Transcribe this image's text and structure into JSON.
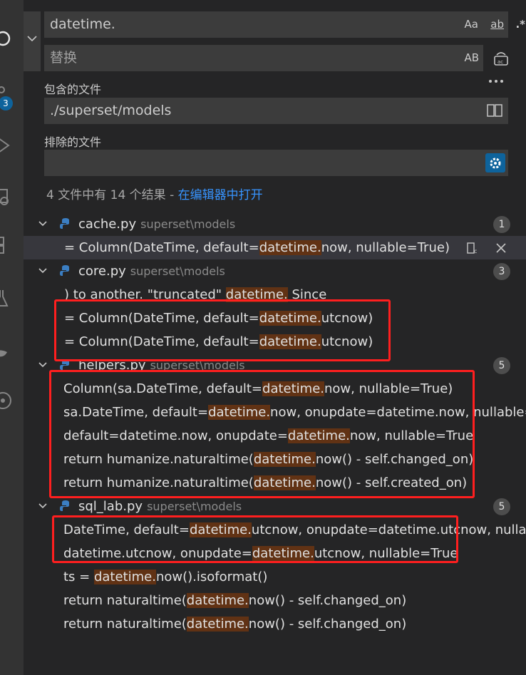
{
  "activity_bar": {
    "badge": "3"
  },
  "search": {
    "find_value": "datetime.",
    "find_options": {
      "match_case": "Aa",
      "whole_word": "ab",
      "regex": ".*"
    },
    "replace_placeholder": "替换",
    "preserve_case": "AB",
    "include_label": "包含的文件",
    "include_value": "./superset/models",
    "exclude_label": "排除的文件",
    "exclude_value": "",
    "summary_text": "4 文件中有 14 个结果 - ",
    "summary_link": "在编辑器中打开"
  },
  "results": [
    {
      "file": "cache.py",
      "path": "superset\\models",
      "count": "1",
      "matches": [
        {
          "pre": "= Column(DateTime, default=",
          "hit": "datetime.",
          "post": "now, nullable=True)"
        }
      ]
    },
    {
      "file": "core.py",
      "path": "superset\\models",
      "count": "3",
      "matches": [
        {
          "pre": ") to another. \"truncated\" ",
          "hit": "datetime.",
          "post": " Since"
        },
        {
          "pre": "= Column(DateTime, default=",
          "hit": "datetime.",
          "post": "utcnow)"
        },
        {
          "pre": "= Column(DateTime, default=",
          "hit": "datetime.",
          "post": "utcnow)"
        }
      ]
    },
    {
      "file": "helpers.py",
      "path": "superset\\models",
      "count": "5",
      "matches": [
        {
          "pre": "Column(sa.DateTime, default=",
          "hit": "datetime.",
          "post": "now, nullable=True)"
        },
        {
          "pre": "sa.DateTime, default=",
          "hit": "datetime.",
          "post": "now, onupdate=datetime.now, nullable=..."
        },
        {
          "pre": "default=datetime.now, onupdate=",
          "hit": "datetime.",
          "post": "now, nullable=True"
        },
        {
          "pre": "return humanize.naturaltime(",
          "hit": "datetime.",
          "post": "now() - self.changed_on)"
        },
        {
          "pre": "return humanize.naturaltime(",
          "hit": "datetime.",
          "post": "now() - self.created_on)"
        }
      ]
    },
    {
      "file": "sql_lab.py",
      "path": "superset\\models",
      "count": "5",
      "matches": [
        {
          "pre": "DateTime, default=",
          "hit": "datetime.",
          "post": "utcnow, onupdate=datetime.utcnow, nullabl..."
        },
        {
          "pre": "datetime.utcnow, onupdate=",
          "hit": "datetime.",
          "post": "utcnow, nullable=True"
        },
        {
          "pre": "ts = ",
          "hit": "datetime.",
          "post": "now().isoformat()"
        },
        {
          "pre": "return naturaltime(",
          "hit": "datetime.",
          "post": "now() - self.changed_on)"
        },
        {
          "pre": "return naturaltime(",
          "hit": "datetime.",
          "post": "now() - self.changed_on)"
        }
      ]
    }
  ],
  "colors": {
    "highlight": "#613214",
    "annotation": "#ff1f1f",
    "link": "#3794ff"
  }
}
